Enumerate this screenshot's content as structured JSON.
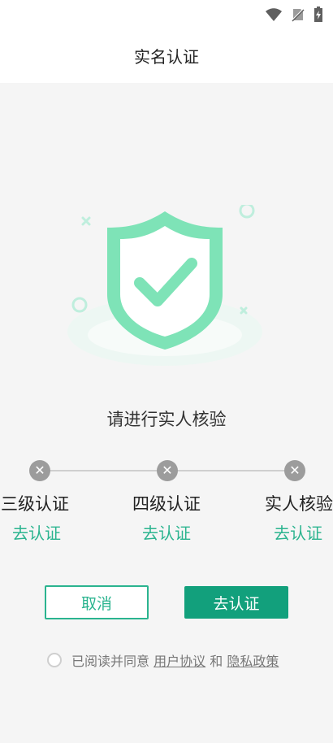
{
  "status_bar": {
    "icons": [
      "wifi-icon",
      "no-sim-icon",
      "battery-charging-icon"
    ]
  },
  "header": {
    "title": "实名认证"
  },
  "hero": {
    "icon": "shield-check-icon",
    "accent_color": "#7ee3b7"
  },
  "verify": {
    "prompt": "请进行实人核验"
  },
  "steps": [
    {
      "title": "三级认证",
      "action": "去认证"
    },
    {
      "title": "四级认证",
      "action": "去认证"
    },
    {
      "title": "实人核验",
      "action": "去认证"
    }
  ],
  "buttons": {
    "cancel": "取消",
    "go": "去认证"
  },
  "agreement": {
    "prefix": "已阅读并同意",
    "user_agreement": "用户协议",
    "and": "和",
    "privacy_policy": "隐私政策"
  },
  "colors": {
    "primary": "#12a07c",
    "link_green": "#2bb48f",
    "grey_dot": "#9c9c9c"
  }
}
